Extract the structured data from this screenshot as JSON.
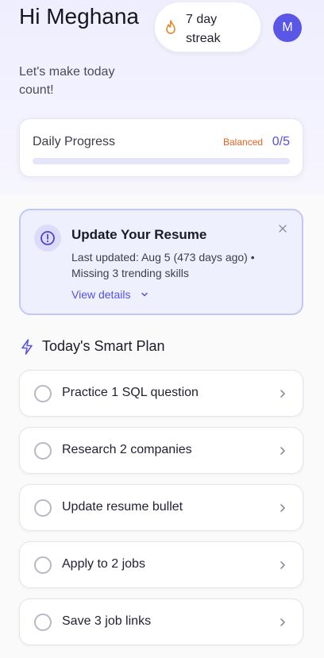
{
  "header": {
    "greeting": "Hi Meghana",
    "subtext": "Let's make today count!",
    "streak_label": "7 day streak",
    "avatar_initial": "M"
  },
  "progress": {
    "title": "Daily Progress",
    "tag": "Balanced",
    "count": "0/5",
    "completed": 0,
    "total": 5
  },
  "alert": {
    "title": "Update Your Resume",
    "line1": "Last updated: Aug 5 (473 days ago) •",
    "line2": "Missing 3 trending skills",
    "link": "View details"
  },
  "plan": {
    "heading": "Today's Smart Plan",
    "tasks": [
      {
        "label": "Practice 1 SQL question"
      },
      {
        "label": "Research 2 companies"
      },
      {
        "label": "Update resume bullet"
      },
      {
        "label": "Apply to 2 jobs"
      },
      {
        "label": "Save 3 job links"
      }
    ]
  },
  "colors": {
    "accent": "#5a56e6",
    "warning": "#e0631c",
    "alert_bg": "#eef0fe"
  },
  "icons": [
    "flame-icon",
    "alert-circle-icon",
    "close-icon",
    "chevron-down-icon",
    "lightning-icon",
    "chevron-right-icon"
  ]
}
